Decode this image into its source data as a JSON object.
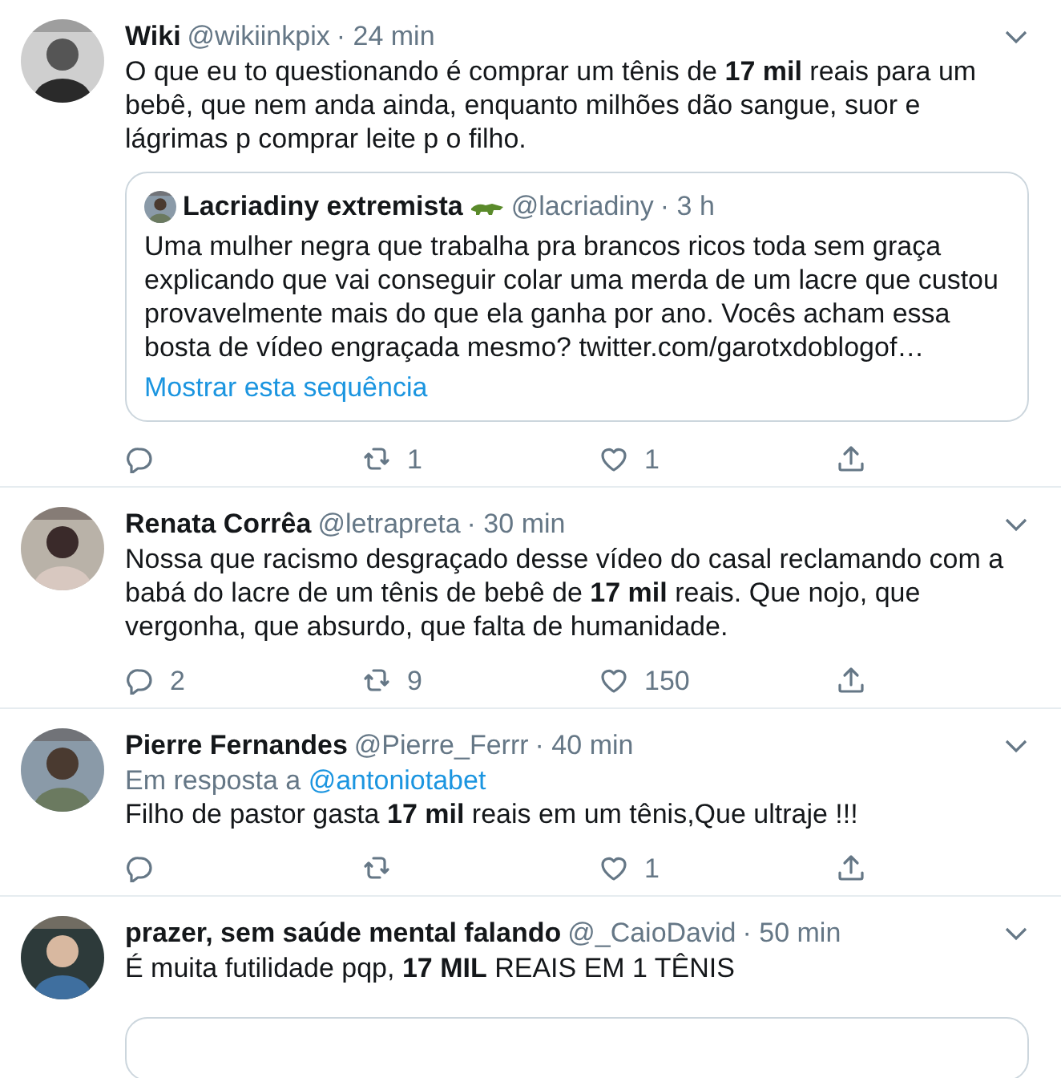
{
  "tweets": [
    {
      "name": "Wiki",
      "handle": "@wikiinkpix",
      "time": "· 24 min",
      "text": "O que eu to questionando é comprar um tênis de **17 mil** reais para um bebê, que nem anda ainda, enquanto milhões dão sangue, suor e lágrimas p comprar leite p o filho.",
      "quote": {
        "name": "Lacriadiny extremista",
        "handle": "@lacriadiny",
        "time": "· 3 h",
        "text": "Uma mulher negra que trabalha pra brancos ricos toda sem graça explicando que vai conseguir colar uma merda de um lacre que custou provavelmente mais do que ela ganha por ano. Vocês acham essa bosta de vídeo engraçada mesmo? twitter.com/garotxdoblogof…",
        "link": "Mostrar esta sequência"
      },
      "retweets": "1",
      "likes": "1"
    },
    {
      "name": "Renata Corrêa",
      "handle": "@letrapreta",
      "time": "· 30 min",
      "text": "Nossa que racismo desgraçado desse vídeo do casal reclamando com a babá do lacre de um tênis de bebê de **17 mil** reais. Que nojo, que vergonha, que absurdo, que falta de humanidade.",
      "replies": "2",
      "retweets": "9",
      "likes": "150"
    },
    {
      "name": "Pierre Fernandes",
      "handle": "@Pierre_Ferrr",
      "time": "· 40 min",
      "reply_to": {
        "label": "Em resposta a",
        "user": "@antoniotabet"
      },
      "text": "Filho de pastor gasta **17 mil** reais em um tênis,Que ultraje !!!",
      "likes": "1"
    },
    {
      "name": "prazer, sem saúde mental falando",
      "handle": "@_CaioDavid",
      "time": "· 50 min",
      "text": "É muita futilidade pqp, **17 MIL** REAIS EM 1 TÊNIS"
    }
  ]
}
